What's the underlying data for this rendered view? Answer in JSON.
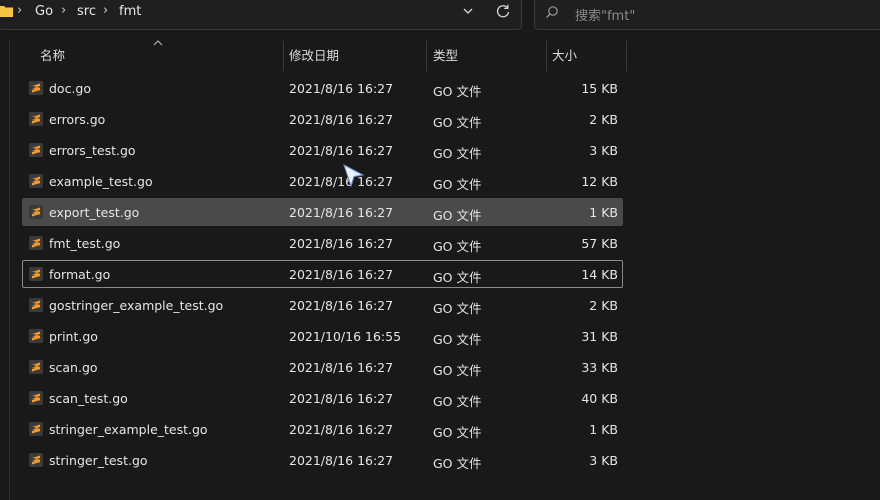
{
  "address": {
    "crumbs": [
      "Go",
      "src",
      "fmt"
    ],
    "separator": "›"
  },
  "search": {
    "placeholder": "搜索\"fmt\""
  },
  "columns": {
    "name": "名称",
    "date": "修改日期",
    "type": "类型",
    "size": "大小"
  },
  "files": [
    {
      "name": "doc.go",
      "date": "2021/8/16 16:27",
      "type": "GO 文件",
      "size": "15 KB"
    },
    {
      "name": "errors.go",
      "date": "2021/8/16 16:27",
      "type": "GO 文件",
      "size": "2 KB"
    },
    {
      "name": "errors_test.go",
      "date": "2021/8/16 16:27",
      "type": "GO 文件",
      "size": "3 KB"
    },
    {
      "name": "example_test.go",
      "date": "2021/8/16 16:27",
      "type": "GO 文件",
      "size": "12 KB"
    },
    {
      "name": "export_test.go",
      "date": "2021/8/16 16:27",
      "type": "GO 文件",
      "size": "1 KB"
    },
    {
      "name": "fmt_test.go",
      "date": "2021/8/16 16:27",
      "type": "GO 文件",
      "size": "57 KB"
    },
    {
      "name": "format.go",
      "date": "2021/8/16 16:27",
      "type": "GO 文件",
      "size": "14 KB"
    },
    {
      "name": "gostringer_example_test.go",
      "date": "2021/8/16 16:27",
      "type": "GO 文件",
      "size": "2 KB"
    },
    {
      "name": "print.go",
      "date": "2021/10/16 16:55",
      "type": "GO 文件",
      "size": "31 KB"
    },
    {
      "name": "scan.go",
      "date": "2021/8/16 16:27",
      "type": "GO 文件",
      "size": "33 KB"
    },
    {
      "name": "scan_test.go",
      "date": "2021/8/16 16:27",
      "type": "GO 文件",
      "size": "40 KB"
    },
    {
      "name": "stringer_example_test.go",
      "date": "2021/8/16 16:27",
      "type": "GO 文件",
      "size": "1 KB"
    },
    {
      "name": "stringer_test.go",
      "date": "2021/8/16 16:27",
      "type": "GO 文件",
      "size": "3 KB"
    }
  ],
  "selected_file": "export_test.go",
  "focused_file": "format.go",
  "icons": {
    "folder": "folder-icon",
    "file": "sublime-file-icon",
    "dropdown": "chevron-down-icon",
    "refresh": "refresh-icon",
    "search": "search-icon"
  },
  "colors": {
    "accent_file_icon": "#f79a28",
    "selection": "#4a4a4a",
    "folder": "#f6c343"
  }
}
